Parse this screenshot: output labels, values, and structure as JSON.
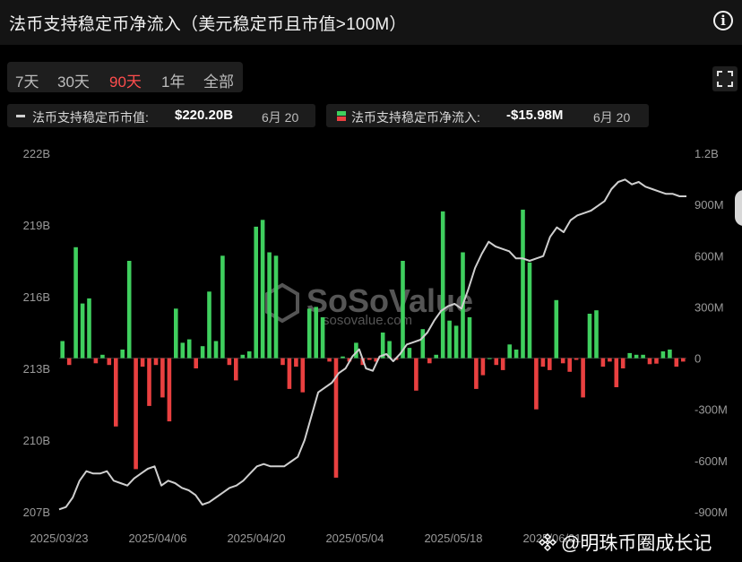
{
  "header": {
    "title": "法币支持稳定币净流入（美元稳定币且市值>100M）"
  },
  "range_tabs": [
    {
      "label": "7天",
      "active": false
    },
    {
      "label": "30天",
      "active": false
    },
    {
      "label": "90天",
      "active": true
    },
    {
      "label": "1年",
      "active": false
    },
    {
      "label": "全部",
      "active": false
    }
  ],
  "legend": {
    "market_cap": {
      "label": "法币支持稳定币市值:",
      "value": "$220.20B",
      "date": "6月 20"
    },
    "net_inflow": {
      "label": "法币支持稳定币净流入:",
      "value": "-$15.98M",
      "date": "6月 20"
    }
  },
  "watermark": {
    "brand": "SoSoValue",
    "url": "sosovalue.com"
  },
  "footer": {
    "text": "@明珠币圈成长记"
  },
  "colors": {
    "positive": "#3fcf5e",
    "negative": "#e94040",
    "line": "#cfcfcf",
    "active_tab": "#ff4d4d"
  },
  "chart_data": {
    "type": "bar+line",
    "x_tick_labels": [
      "2025/03/23",
      "2025/04/06",
      "2025/04/20",
      "2025/05/04",
      "2025/05/18",
      "2025/06/01"
    ],
    "left_axis": {
      "ticks": [
        "222B",
        "219B",
        "216B",
        "213B",
        "210B",
        "207B"
      ],
      "ylim": [
        207,
        222
      ]
    },
    "right_axis": {
      "ticks": [
        "1.2B",
        "900M",
        "600M",
        "300M",
        "0",
        "-300M",
        "-600M",
        "-900M"
      ],
      "ylim": [
        -900,
        1200
      ]
    },
    "series": [
      {
        "name": "法币支持稳定币净流入",
        "type": "bar",
        "unit": "M",
        "values": [
          100,
          -40,
          650,
          320,
          350,
          -30,
          20,
          -40,
          -400,
          50,
          570,
          -650,
          -50,
          -280,
          -40,
          -230,
          -370,
          290,
          90,
          110,
          -60,
          70,
          390,
          100,
          600,
          -40,
          -130,
          20,
          40,
          770,
          810,
          620,
          600,
          -40,
          -180,
          -50,
          -200,
          290,
          300,
          240,
          -20,
          -700,
          10,
          -20,
          90,
          -40,
          -10,
          -20,
          150,
          100,
          -10,
          570,
          60,
          -190,
          170,
          -30,
          20,
          860,
          220,
          190,
          620,
          240,
          -180,
          -100,
          0,
          -40,
          -70,
          80,
          50,
          870,
          560,
          -300,
          -50,
          -70,
          340,
          -30,
          -80,
          -10,
          -230,
          260,
          280,
          -50,
          -20,
          -170,
          -60,
          30,
          20,
          20,
          -35,
          -32,
          40,
          50,
          -50,
          -20
        ],
        "values_note": ""
      },
      {
        "name": "法币支持稳定币市值",
        "type": "line",
        "unit": "B",
        "values": [
          207.1,
          207.2,
          207.6,
          208.3,
          208.7,
          208.6,
          208.6,
          208.7,
          208.3,
          208.2,
          208.1,
          208.4,
          208.6,
          208.8,
          208.9,
          208.1,
          208.3,
          208.2,
          208.0,
          207.9,
          207.7,
          207.3,
          207.4,
          207.6,
          207.8,
          208.0,
          208.1,
          208.3,
          208.6,
          208.9,
          209.0,
          208.9,
          208.9,
          208.9,
          209.1,
          209.3,
          210.0,
          211.0,
          212.0,
          212.2,
          212.4,
          212.8,
          213.0,
          213.5,
          213.8,
          213.0,
          212.9,
          213.5,
          213.6,
          213.3,
          213.6,
          214.0,
          214.1,
          214.2,
          214.5,
          215.0,
          215.4,
          215.6,
          215.7,
          215.5,
          216.3,
          217.2,
          217.8,
          218.3,
          218.1,
          218.0,
          217.9,
          217.6,
          217.6,
          217.5,
          217.6,
          217.7,
          218.5,
          218.9,
          218.7,
          219.2,
          219.4,
          219.5,
          219.6,
          219.8,
          220.0,
          220.5,
          220.8,
          220.9,
          220.7,
          220.8,
          220.6,
          220.5,
          220.4,
          220.3,
          220.3,
          220.2,
          220.2
        ]
      }
    ]
  }
}
